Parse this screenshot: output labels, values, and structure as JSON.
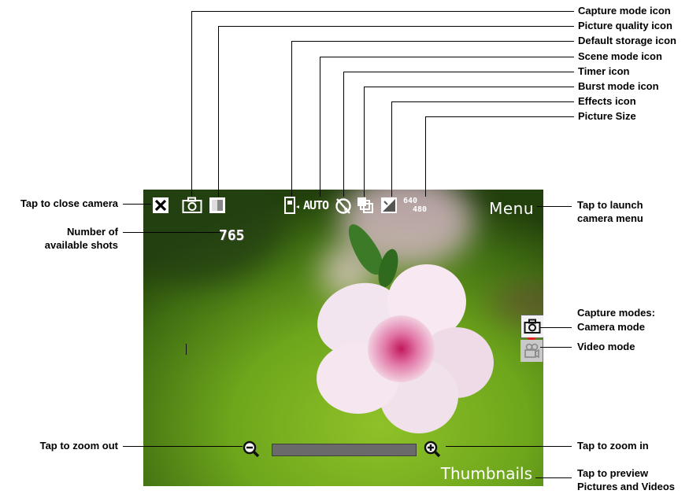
{
  "callouts": {
    "capture_mode_icon": "Capture mode icon",
    "picture_quality_icon": "Picture quality icon",
    "default_storage_icon": "Default storage icon",
    "scene_mode_icon": "Scene mode icon",
    "timer_icon": "Timer icon",
    "burst_mode_icon": "Burst mode icon",
    "effects_icon": "Effects icon",
    "picture_size": "Picture Size",
    "close_camera": "Tap to close camera",
    "available_shots_1": "Number of",
    "available_shots_2": "available shots",
    "launch_menu_1": "Tap to launch",
    "launch_menu_2": "camera menu",
    "capture_modes_1": "Capture modes:",
    "capture_modes_2": "Camera mode",
    "video_mode": "Video mode",
    "zoom_out": "Tap to zoom out",
    "zoom_in": "Tap to zoom in",
    "preview_1": "Tap to preview",
    "preview_2": "Pictures and Videos"
  },
  "screen": {
    "scene_mode_label": "AUTO",
    "picture_size_top": "640",
    "picture_size_bottom": "480",
    "available_shots": "765",
    "menu_label": "Menu",
    "thumbnails_label": "Thumbnails"
  },
  "icons": {
    "close": "close-x-icon",
    "capture_mode": "camera-icon",
    "picture_quality": "quality-square-icon",
    "storage": "storage-card-icon",
    "timer": "timer-off-icon",
    "burst": "burst-icon",
    "effects": "effects-icon",
    "zoom_out": "zoom-out-icon",
    "zoom_in": "zoom-in-icon",
    "camera_mode": "camera-mode-icon",
    "video_mode": "video-mode-icon"
  },
  "colors": {
    "mode_indicator": "#e02020"
  }
}
